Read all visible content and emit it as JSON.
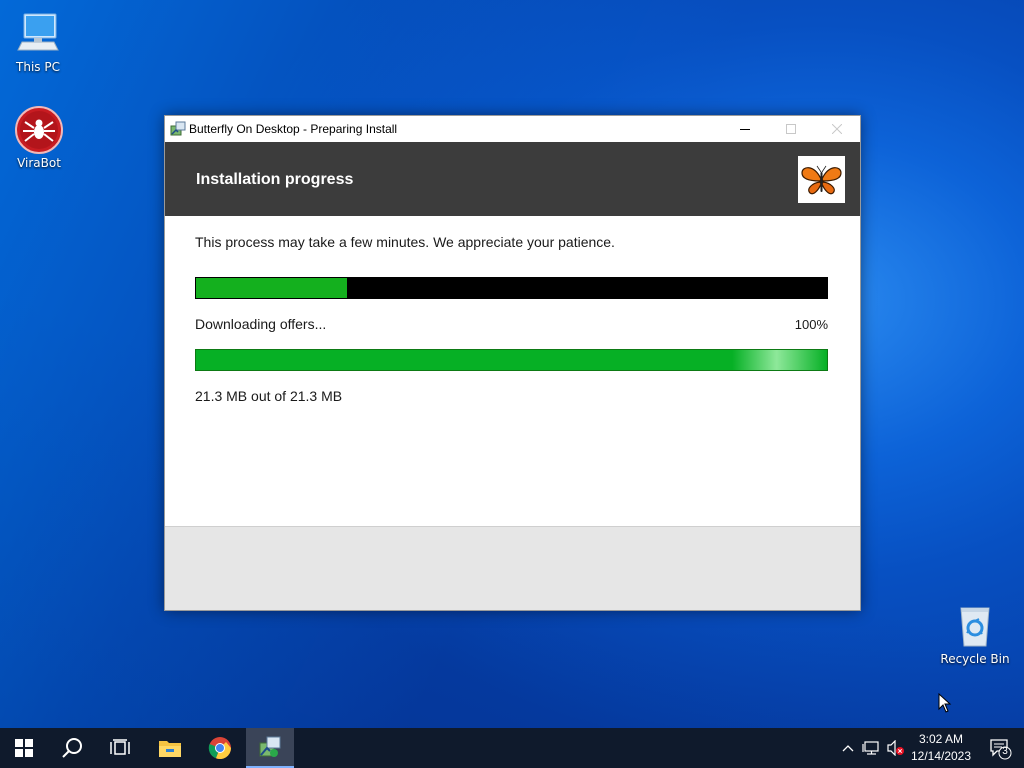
{
  "desktop": {
    "icons": [
      {
        "label": "This PC",
        "icon": "computer-icon"
      },
      {
        "label": "ViraBot",
        "icon": "spider-logo-icon"
      },
      {
        "label": "Recycle Bin",
        "icon": "recycle-bin-icon"
      }
    ]
  },
  "window": {
    "title": "Butterfly On Desktop - Preparing Install",
    "header_title": "Installation progress",
    "message": "This process may take a few minutes. We appreciate your patience.",
    "overall_progress_fraction": 0.24,
    "status": "Downloading offers...",
    "download_percent_label": "100%",
    "download_progress_fraction": 1.0,
    "size_text": "21.3 MB out of 21.3 MB",
    "colors": {
      "header_bg": "#3c3c3c",
      "progress_green": "#14b01e"
    }
  },
  "taskbar": {
    "apps": [
      "windows-start-icon",
      "search-icon",
      "task-view-icon",
      "file-explorer-icon",
      "chrome-icon",
      "installer-icon"
    ],
    "tray": {
      "time": "3:02 AM",
      "date": "12/14/2023",
      "notification_count": "3"
    }
  }
}
